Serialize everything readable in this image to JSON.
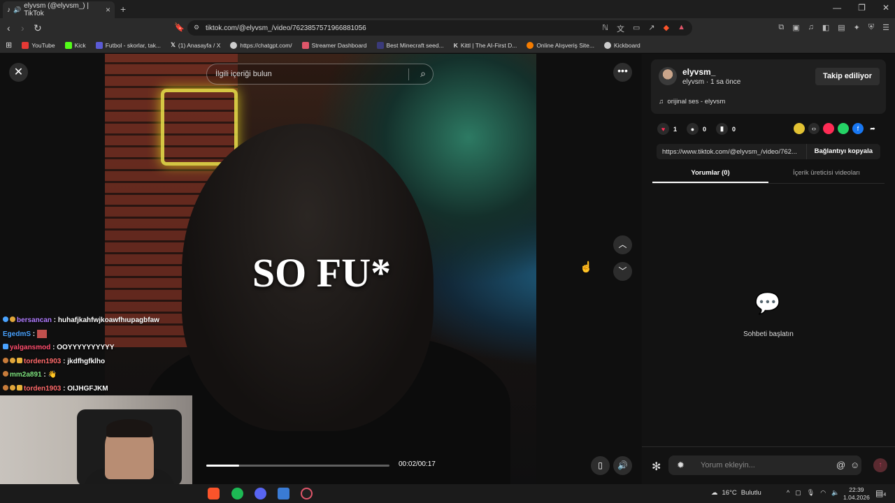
{
  "browser": {
    "tab_title": "elyvsm (@elyvsm_) | TikTok",
    "tab_close": "×",
    "new_tab": "+",
    "url": "tiktok.com/@elyvsm_/video/7623857571966881056",
    "window_controls": [
      "—",
      "❐",
      "✕"
    ],
    "bookmarks": [
      {
        "label": "YouTube",
        "color": "#e53935"
      },
      {
        "label": "Kick",
        "color": "#53fc18"
      },
      {
        "label": "Futbol - skorlar, tak...",
        "color": "#5b5bd6"
      },
      {
        "label": "(1) Anasayfa / X",
        "color": "#ffffff"
      },
      {
        "label": "https://chatgpt.com/",
        "color": "#cccccc"
      },
      {
        "label": "Streamer Dashboard",
        "color": "#e0566a"
      },
      {
        "label": "Best Minecraft seed...",
        "color": "#3a3a7a"
      },
      {
        "label": "Kittl | The AI-First D...",
        "color": "#ffffff"
      },
      {
        "label": "Online Alışveriş Site...",
        "color": "#f57c00"
      },
      {
        "label": "Kickboard",
        "color": "#cccccc"
      }
    ]
  },
  "video": {
    "search_placeholder": "İlgili içeriği bulun",
    "overlay_text": "SO FU*",
    "time": "00:02/00:17",
    "progress": 0.18
  },
  "chat": [
    {
      "user": "bersancan",
      "user_color": "#b07cff",
      "message": "huhafjkahfwjkoawfhıupagbfaw",
      "badges": 2
    },
    {
      "user": "EgedmS",
      "user_color": "#4aa3ff",
      "message": "",
      "badges": 0
    },
    {
      "user": "yalgansmod",
      "user_color": "#ff4d6d",
      "message": "OOYYYYYYYYYY",
      "badges": 1
    },
    {
      "user": "torden1903",
      "user_color": "#ff6b6b",
      "message": "jkdfhgfklho",
      "badges": 3
    },
    {
      "user": "mm2a891",
      "user_color": "#7ee37e",
      "message": "",
      "badges": 1
    },
    {
      "user": "torden1903",
      "user_color": "#ff6b6b",
      "message": "OIJHGFJKM",
      "badges": 3
    }
  ],
  "sidebar": {
    "author_name": "elyvsm_",
    "author_sub": "elyvsm · 1 sa önce",
    "follow_label": "Takip ediliyor",
    "music": "orijinal ses - elyvsm",
    "likes": "1",
    "comments": "0",
    "saves": "0",
    "link": "https://www.tiktok.com/@elyvsm_/video/762...",
    "copy_label": "Bağlantıyı kopyala",
    "tab_comments": "Yorumlar (0)",
    "tab_creator": "İçerik üreticisi videoları",
    "empty_text": "Sohbeti başlatın",
    "comment_placeholder": "Yorum ekleyin..."
  },
  "taskbar": {
    "weather_temp": "16°C",
    "weather_text": "Bulutlu",
    "time": "22:39",
    "date": "1.04.2026",
    "notif_count": "4"
  }
}
